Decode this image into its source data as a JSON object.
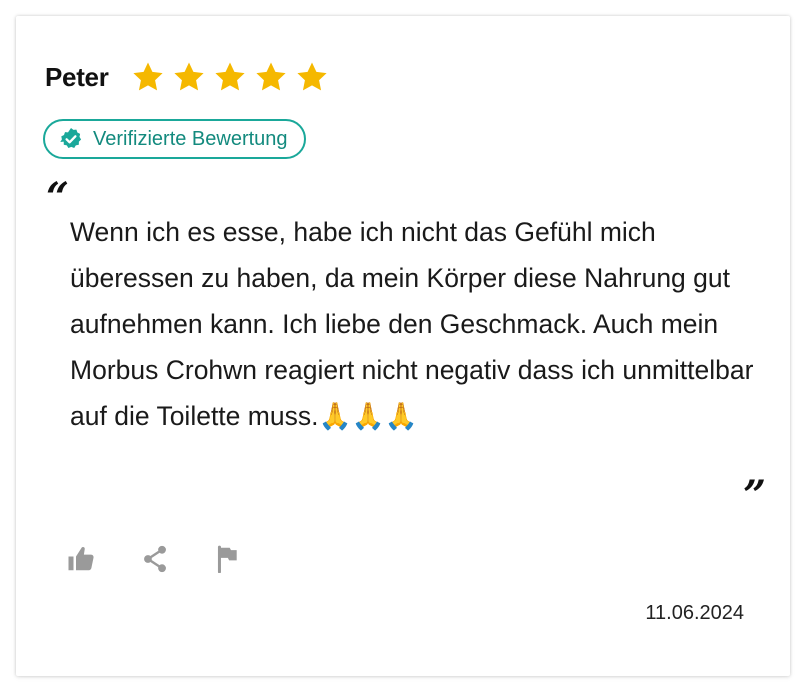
{
  "review": {
    "author": "Peter",
    "rating": 5,
    "rating_max": 5,
    "star_color": "#F5B800",
    "verified_label": "Verifizierte Bewertung",
    "verified_color": "#1AA89A",
    "open_quote": "“",
    "text": "Wenn ich es esse, habe ich nicht das Gefühl mich überessen zu haben, da mein Körper diese Nahrung gut aufnehmen kann. Ich liebe den Geschmack. Auch mein Morbus Crohwn reagiert nicht negativ dass ich unmittelbar auf die Toilette muss.🙏🙏🙏",
    "close_quote": "”",
    "date": "11.06.2024"
  },
  "icons": {
    "verified": "check-badge-icon",
    "like": "thumbs-up-icon",
    "share": "share-icon",
    "report": "flag-icon",
    "star": "star-icon"
  }
}
